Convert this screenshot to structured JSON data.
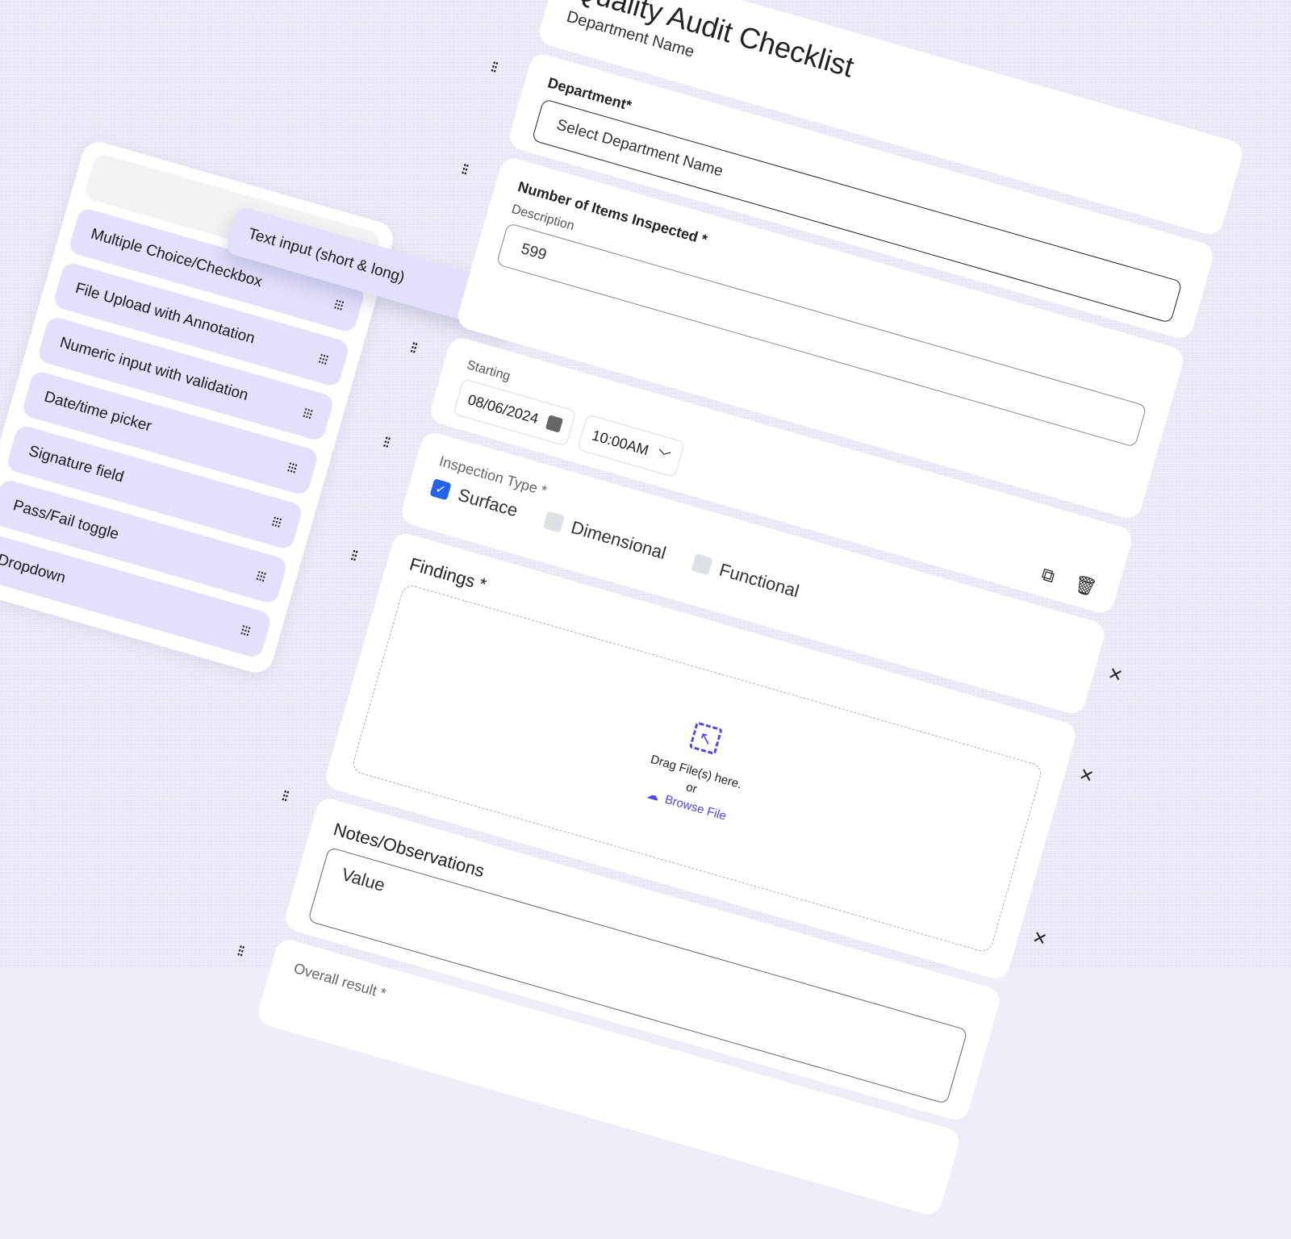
{
  "palette": {
    "dragging_label": "Text input (short & long)",
    "items": [
      "Multiple Choice/Checkbox",
      "File Upload with Annotation",
      "Numeric input with validation",
      "Date/time picker",
      "Signature field",
      "Pass/Fail toggle",
      "Dropdown",
      ""
    ]
  },
  "form": {
    "title": "Quality Audit Checklist",
    "subtitle": "Department Name",
    "department": {
      "label": "Department*",
      "placeholder": "Select Department Name"
    },
    "items_inspected": {
      "label": "Number of Items Inspected *",
      "sublabel": "Description",
      "value": "599"
    },
    "schedule": {
      "label": "Starting",
      "date": "08/06/2024",
      "time": "10:00AM"
    },
    "inspection_type": {
      "label": "Inspection Type *",
      "options": [
        {
          "label": "Surface",
          "checked": true
        },
        {
          "label": "Dimensional",
          "checked": false
        },
        {
          "label": "Functional",
          "checked": false
        }
      ]
    },
    "findings": {
      "label": "Findings *",
      "drag_text": "Drag File(s) here.",
      "or_text": "or",
      "browse_text": "Browse File"
    },
    "notes": {
      "label": "Notes/Observations",
      "value": "Value"
    },
    "overall_result": {
      "label": "Overall result *"
    }
  },
  "icons": {
    "grip": "drag-grip-icon",
    "calendar": "calendar-icon",
    "copy": "copy-icon",
    "delete": "trash-icon",
    "close": "close-icon",
    "upload": "upload-cloud-icon",
    "cursor": "hand-cursor-icon"
  },
  "colors": {
    "palette_item": "#e2e0fb",
    "accent": "#4f46e5",
    "checkbox_checked": "#2563eb",
    "background": "#eeeef8"
  }
}
